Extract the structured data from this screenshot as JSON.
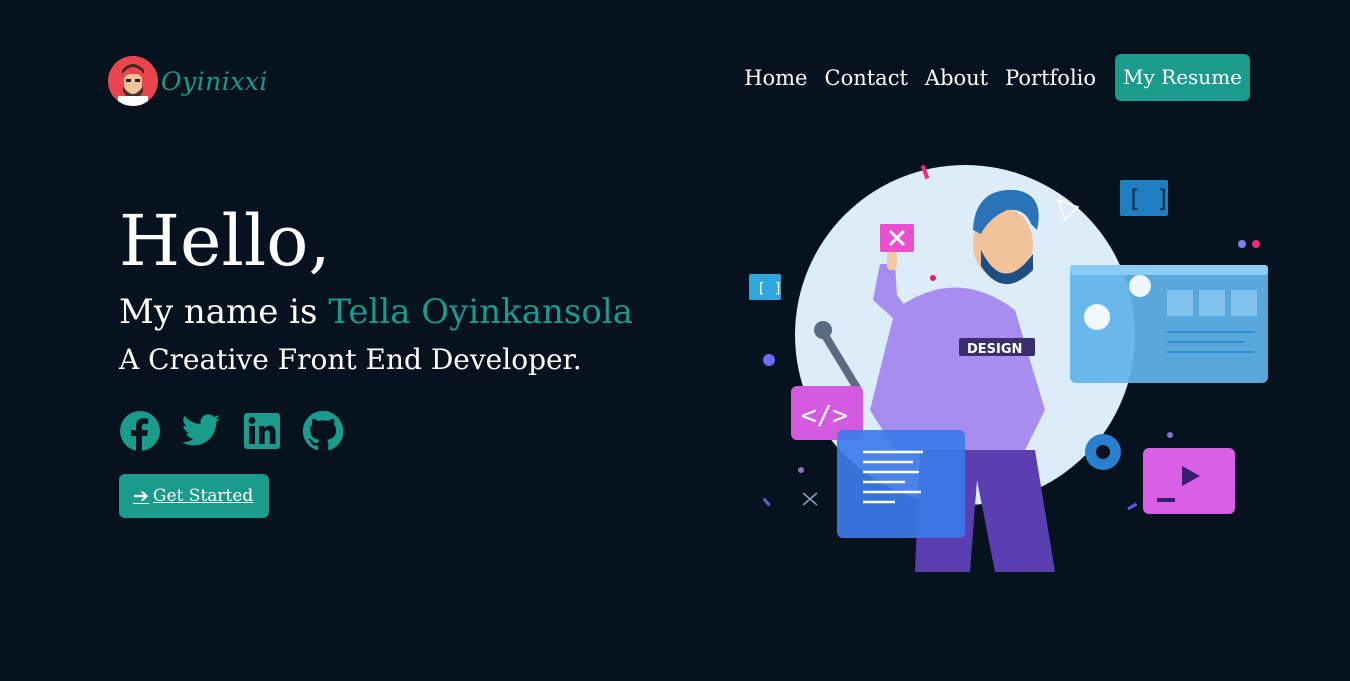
{
  "brand": {
    "name": "Oyinixxi"
  },
  "nav": {
    "items": [
      "Home",
      "Contact",
      "About",
      "Portfolio"
    ],
    "resume_label": "My Resume"
  },
  "hero": {
    "greeting": "Hello,",
    "name_prefix": "My name is",
    "name": "Tella Oyinkansola",
    "role": "A Creative Front End Developer.",
    "cta_label": "Get Started"
  },
  "socials": [
    "facebook-icon",
    "twitter-icon",
    "linkedin-icon",
    "github-icon"
  ],
  "illustration": {
    "badge_text": "DESIGN"
  },
  "colors": {
    "background": "#07121f",
    "accent": "#1a9b8c",
    "text": "#ffffff"
  }
}
